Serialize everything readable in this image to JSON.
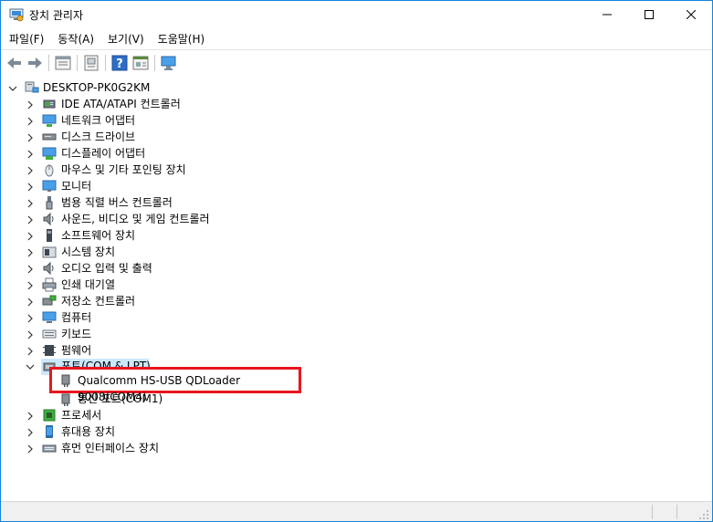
{
  "window": {
    "title": "장치 관리자"
  },
  "menu": [
    "파일(F)",
    "동작(A)",
    "보기(V)",
    "도움말(H)"
  ],
  "toolbar": {
    "buttons": [
      "back-icon",
      "forward-icon",
      "properties-icon",
      "update-driver-icon",
      "help-icon",
      "console-icon",
      "scan-hardware-icon"
    ]
  },
  "tree": {
    "root": "DESKTOP-PK0G2KM",
    "categories": [
      {
        "label": "IDE ATA/ATAPI 컨트롤러",
        "icon": "ide-controller-icon"
      },
      {
        "label": "네트워크 어댑터",
        "icon": "network-adapter-icon"
      },
      {
        "label": "디스크 드라이브",
        "icon": "disk-drive-icon"
      },
      {
        "label": "디스플레이 어댑터",
        "icon": "display-adapter-icon"
      },
      {
        "label": "마우스 및 기타 포인팅 장치",
        "icon": "mouse-icon"
      },
      {
        "label": "모니터",
        "icon": "monitor-icon"
      },
      {
        "label": "범용 직렬 버스 컨트롤러",
        "icon": "usb-icon"
      },
      {
        "label": "사운드, 비디오 및 게임 컨트롤러",
        "icon": "sound-icon"
      },
      {
        "label": "소프트웨어 장치",
        "icon": "software-device-icon"
      },
      {
        "label": "시스템 장치",
        "icon": "system-device-icon"
      },
      {
        "label": "오디오 입력 및 출력",
        "icon": "audio-icon"
      },
      {
        "label": "인쇄 대기열",
        "icon": "printer-icon"
      },
      {
        "label": "저장소 컨트롤러",
        "icon": "storage-controller-icon"
      },
      {
        "label": "컴퓨터",
        "icon": "computer-icon"
      },
      {
        "label": "키보드",
        "icon": "keyboard-icon"
      },
      {
        "label": "펌웨어",
        "icon": "firmware-icon"
      }
    ],
    "ports": {
      "label": "포트(COM & LPT)",
      "children": [
        "Qualcomm HS-USB QDLoader 9008(COM4)",
        "통신 포트(COM1)"
      ]
    },
    "after": [
      {
        "label": "프로세서",
        "icon": "processor-icon"
      },
      {
        "label": "휴대용 장치",
        "icon": "portable-device-icon"
      },
      {
        "label": "휴먼 인터페이스 장치",
        "icon": "hid-icon"
      }
    ]
  },
  "colors": {
    "highlight": "#e8161f",
    "accent": "#1883d7",
    "selection": "#cce8ff"
  }
}
